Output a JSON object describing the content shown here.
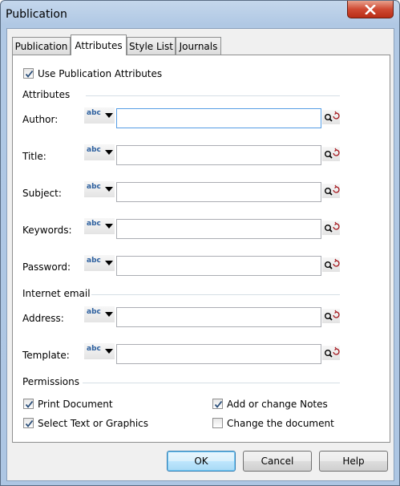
{
  "window": {
    "title": "Publication"
  },
  "tabs": [
    {
      "label": "Publication"
    },
    {
      "label": "Attributes"
    },
    {
      "label": "Style List"
    },
    {
      "label": "Journals"
    }
  ],
  "use_attributes": {
    "label": "Use Publication Attributes",
    "checked": true
  },
  "attributes_group": {
    "title": "Attributes",
    "fields": [
      {
        "label": "Author:",
        "value": "",
        "type_label": "abc"
      },
      {
        "label": "Title:",
        "value": "",
        "type_label": "abc"
      },
      {
        "label": "Subject:",
        "value": "",
        "type_label": "abc"
      },
      {
        "label": "Keywords:",
        "value": "",
        "type_label": "abc"
      },
      {
        "label": "Password:",
        "value": "",
        "type_label": "abc"
      }
    ]
  },
  "email_group": {
    "title": "Internet email",
    "fields": [
      {
        "label": "Address:",
        "value": "",
        "type_label": "abc"
      },
      {
        "label": "Template:",
        "value": "",
        "type_label": "abc"
      }
    ]
  },
  "permissions": {
    "title": "Permissions",
    "items": [
      {
        "label": "Print Document",
        "checked": true
      },
      {
        "label": "Add or change Notes",
        "checked": true
      },
      {
        "label": "Select Text or Graphics",
        "checked": true
      },
      {
        "label": "Change the document",
        "checked": false
      }
    ]
  },
  "buttons": {
    "ok": "OK",
    "cancel": "Cancel",
    "help": "Help"
  },
  "colors": {
    "close_button": "#cf4a33",
    "focus_border": "#569de5",
    "titlebar": "#b0c8e4"
  },
  "icons": [
    "close-icon",
    "dropdown-arrow-icon",
    "lookup-icon",
    "checkmark-icon"
  ]
}
